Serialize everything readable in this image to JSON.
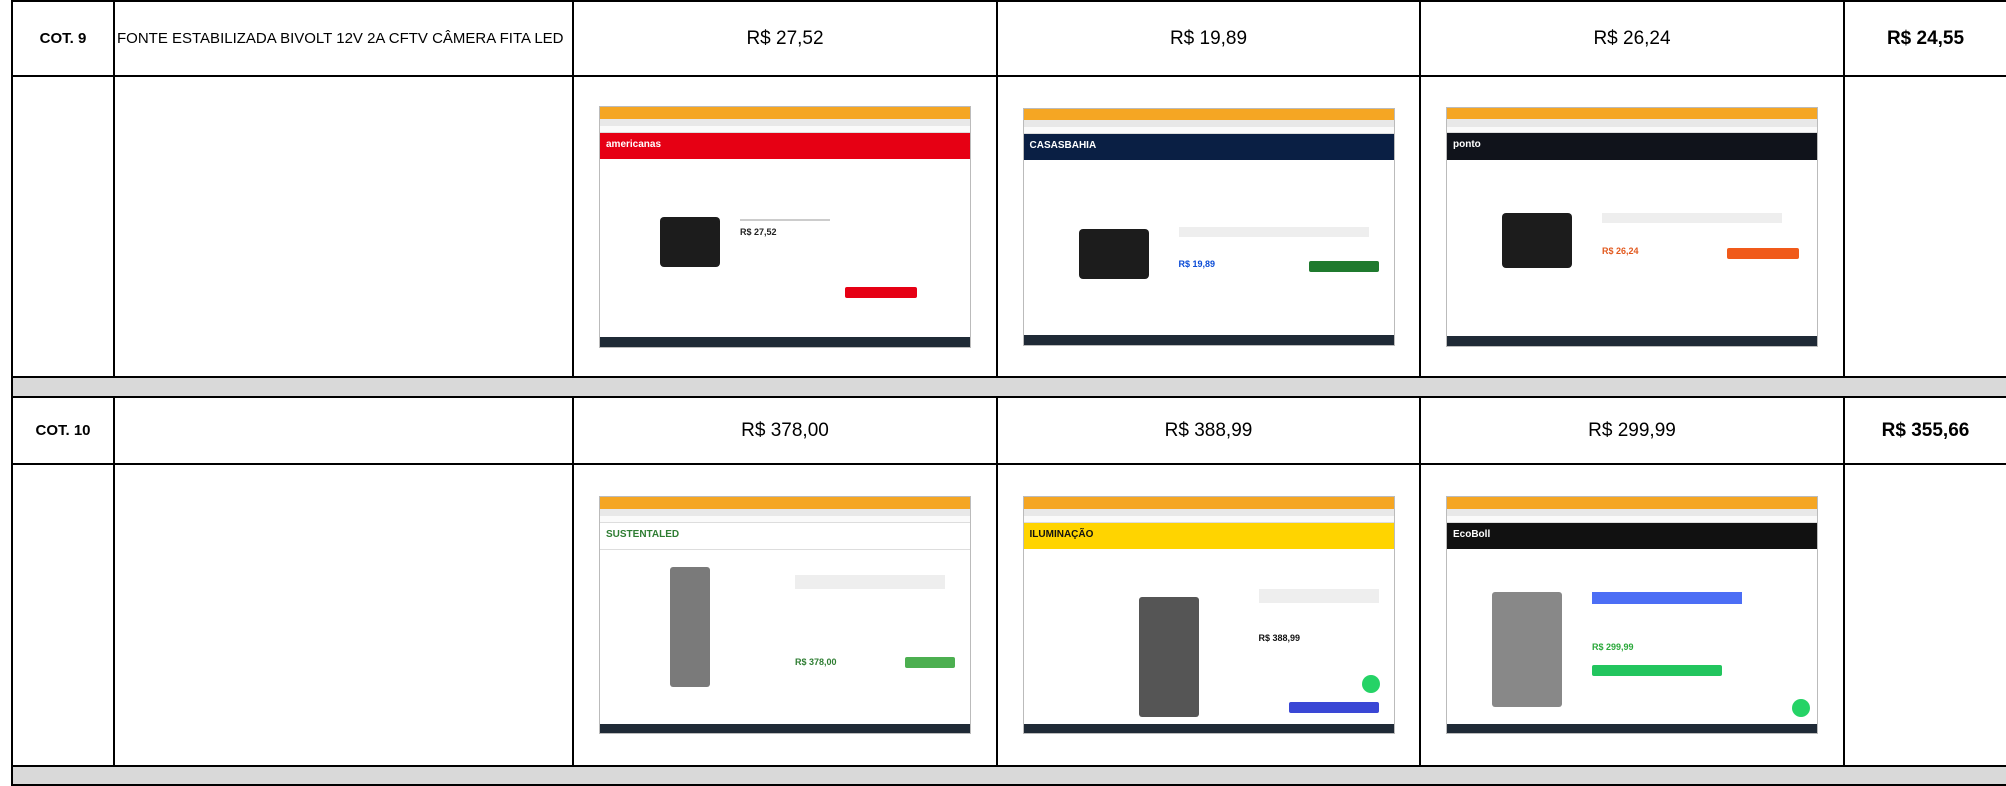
{
  "rows": [
    {
      "label": "COT. 9",
      "description": "FONTE ESTABILIZADA BIVOLT 12V 2A CFTV CÂMERA FITA LED",
      "prices": [
        "R$ 27,52",
        "R$ 19,89",
        "R$ 26,24"
      ],
      "average": "R$ 24,55",
      "screens": [
        {
          "site_logo": "americanas",
          "product_icon": "power-adapter-icon",
          "theme": "#e60014",
          "price": "R$ 27,52"
        },
        {
          "site_logo": "CASASBAHIA",
          "product_icon": "power-adapter-icon",
          "theme": "#0a1f44",
          "price": "R$ 19,89"
        },
        {
          "site_logo": "ponto",
          "product_icon": "power-adapter-icon",
          "theme": "#10131b",
          "price": "R$ 26,24"
        }
      ]
    },
    {
      "label": "COT. 10",
      "description": "",
      "prices": [
        "R$ 378,00",
        "R$ 388,99",
        "R$ 299,99"
      ],
      "average": "R$ 355,66",
      "screens": [
        {
          "site_logo": "SUSTENTALED",
          "product_icon": "street-light-icon",
          "theme": "#4caf50",
          "price": "R$ 378,00"
        },
        {
          "site_logo": "ILUMINAÇÃO",
          "product_icon": "street-light-icon",
          "theme": "#ffd400",
          "price": "R$ 388,99"
        },
        {
          "site_logo": "EcoBoll",
          "product_icon": "street-light-icon",
          "theme": "#111111",
          "price": "R$ 299,99"
        }
      ]
    }
  ]
}
